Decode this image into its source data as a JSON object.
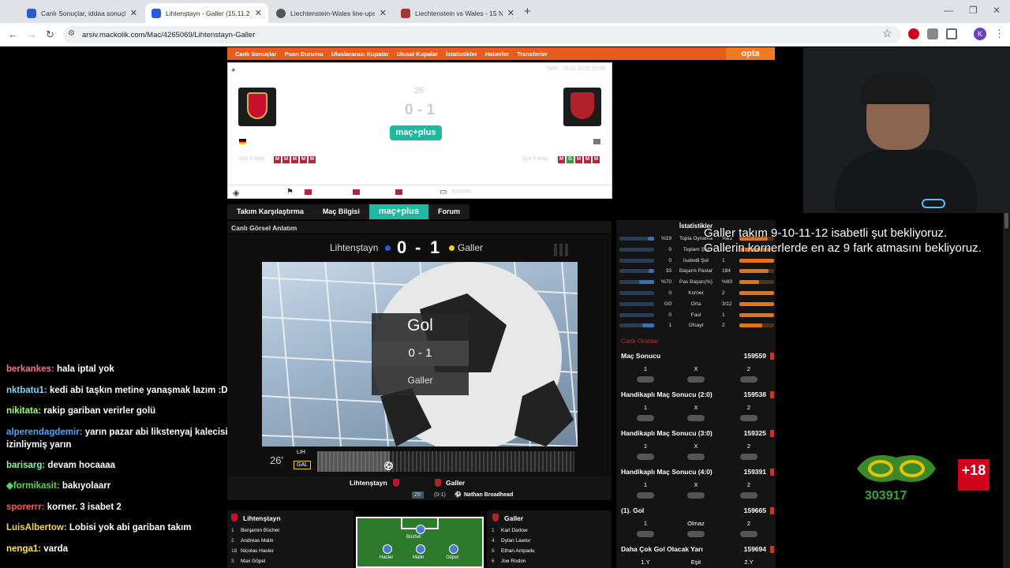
{
  "browser": {
    "tabs": [
      {
        "title": "Canlı Sonuçlar, iddaa sonuçları"
      },
      {
        "title": "Lihtenştayn - Galler (15.11.2025"
      },
      {
        "title": "Liechtenstein-Wales line-ups | E"
      },
      {
        "title": "Liechtenstein vs Wales - 15 Nov"
      }
    ],
    "url": "arsiv.mackolik.com/Mac/4265069/Lihtenstayn-Galler",
    "profile_initial": "K"
  },
  "site": {
    "nav": [
      "Canlı Sonuçlar",
      "Puan Durumu",
      "Uluslararası Kupalar",
      "Ulusal Kupalar",
      "İstatistikler",
      "Haberler",
      "Transferler"
    ],
    "opta": "opta",
    "date": "Tarih : 15.11.2025 20:00",
    "minute": "26'",
    "score": "0 - 1",
    "macplus": "maç+plus",
    "last5_label": "Son 5 Maç",
    "home_form": [
      "M",
      "M",
      "M",
      "M",
      "M"
    ],
    "away_form": [
      "M",
      "G",
      "M",
      "M",
      "M"
    ],
    "exxen": "EXXEN",
    "tabs": [
      "Takım Karşılaştırma",
      "Maç Bilgisi",
      "maç+plus",
      "Forum"
    ],
    "section_title": "Canlı Görsel Anlatım"
  },
  "visual": {
    "home": "Lihtenştayn",
    "away": "Galler",
    "home_score": "0",
    "dash": "-",
    "away_score": "1",
    "gol_title": "Gol",
    "gol_score": "0 - 1",
    "gol_team": "Galler",
    "minute": "26'",
    "home_abbr": "LIH",
    "away_abbr": "GAL"
  },
  "lineup_bar": {
    "home": "Lihtenştayn",
    "away": "Galler",
    "event_minute": "25'",
    "event_score": "(0-1)",
    "event_player": "Nathan Broadhead"
  },
  "lineups": {
    "home_title": "Lihtenştayn",
    "away_title": "Galler",
    "home_players": [
      {
        "no": "1",
        "name": "Benjamin Büchel"
      },
      {
        "no": "2",
        "name": "Andreas Malin"
      },
      {
        "no": "18",
        "name": "Nicolas Hasler"
      },
      {
        "no": "3",
        "name": "Max Göpel"
      }
    ],
    "away_players": [
      {
        "no": "1",
        "name": "Karl Darlow"
      },
      {
        "no": "4",
        "name": "Dylan Lawlor"
      },
      {
        "no": "5",
        "name": "Ethan Ampadu"
      },
      {
        "no": "6",
        "name": "Joe Rodon"
      }
    ],
    "pitch_labels": [
      "Büchel",
      "Hasler",
      "Malin",
      "Göpel"
    ]
  },
  "stats": {
    "title": "İstatistikler",
    "rows": [
      {
        "home": "%19",
        "label": "Topla Oynama",
        "away": "%81",
        "home_pct": 0.19,
        "away_pct": 0.81
      },
      {
        "home": "0",
        "label": "Toplam Şut",
        "away": "",
        "home_pct": 0.0,
        "away_pct": 0.9
      },
      {
        "home": "0",
        "label": "İsabetli Şut",
        "away": "1",
        "home_pct": 0.0,
        "away_pct": 1.0
      },
      {
        "home": "33",
        "label": "Başarılı Paslar",
        "away": "184",
        "home_pct": 0.15,
        "away_pct": 0.85
      },
      {
        "home": "%70",
        "label": "Pas Başarı(%)",
        "away": "%93",
        "home_pct": 0.43,
        "away_pct": 0.57
      },
      {
        "home": "0",
        "label": "Korner",
        "away": "2",
        "home_pct": 0.0,
        "away_pct": 1.0
      },
      {
        "home": "0/0",
        "label": "Orta",
        "away": "3/12",
        "home_pct": 0.0,
        "away_pct": 1.0
      },
      {
        "home": "0",
        "label": "Faul",
        "away": "1",
        "home_pct": 0.0,
        "away_pct": 1.0
      },
      {
        "home": "1",
        "label": "Ofsayt",
        "away": "2",
        "home_pct": 0.33,
        "away_pct": 0.67
      }
    ]
  },
  "odds": {
    "title": "Canlı Oranlar",
    "markets": [
      {
        "name": "Maç Sonucu",
        "id": "159559",
        "cols": [
          "1",
          "X",
          "2"
        ]
      },
      {
        "name": "Handikaplı Maç Sonucu (2:0)",
        "id": "159538",
        "cols": [
          "1",
          "X",
          "2"
        ]
      },
      {
        "name": "Handikaplı Maç Sonucu (3:0)",
        "id": "159325",
        "cols": [
          "1",
          "X",
          "2"
        ]
      },
      {
        "name": "Handikaplı Maç Sonucu (4:0)",
        "id": "159391",
        "cols": [
          "1",
          "X",
          "2"
        ]
      },
      {
        "name": "(1). Gol",
        "id": "159665",
        "cols": [
          "1",
          "Olmaz",
          "2"
        ]
      },
      {
        "name": "Daha Çok Gol Olacak Yarı",
        "id": "159694",
        "cols": [
          "1.Y",
          "Eşit",
          "2.Y"
        ]
      }
    ]
  },
  "chat": [
    {
      "user": "berkankes:",
      "msg": "hala iptal yok",
      "color": "#ff6b8a"
    },
    {
      "user": "nktbatu1:",
      "msg": "kedi abi taşkın metine yanaşmak lazım :D",
      "color": "#7fd7ff"
    },
    {
      "user": "nikitata:",
      "msg": "rakip gariban verirler golü",
      "color": "#9cff6b"
    },
    {
      "user": "alperendagdemir:",
      "msg": "yarın pazar abi likstenyaj kalecisi izinliymiş yarın",
      "color": "#4aa3ff"
    },
    {
      "user": "barisarg:",
      "msg": "devam hocaaaa",
      "color": "#7fff9c"
    },
    {
      "user": "formikasit:",
      "msg": "bakıyolaarr",
      "color": "#5ad65a"
    },
    {
      "user": "sporerrr:",
      "msg": "korner. 3 isabet 2",
      "color": "#ff5a5a"
    },
    {
      "user": "LuisAlbertow:",
      "msg": "Lobisi yok abi gariban takım",
      "color": "#ffd24a"
    },
    {
      "user": "nenga1:",
      "msg": "varda",
      "color": "#ffe84a"
    }
  ],
  "overlay": {
    "line1": "Galler takım 9-10-11-12 isabetli şut bekliyoruz.",
    "line2": "Gallerin kornerlerde en az 9 fark atmasını bekliyoruz."
  },
  "sponsor": {
    "code": "303917",
    "age": "+18"
  },
  "colors": {
    "accent_orange": "#e65c1a",
    "macplus_teal": "#1fb8a0",
    "home_blue": "#3a6fb5",
    "away_orange": "#e07320"
  }
}
